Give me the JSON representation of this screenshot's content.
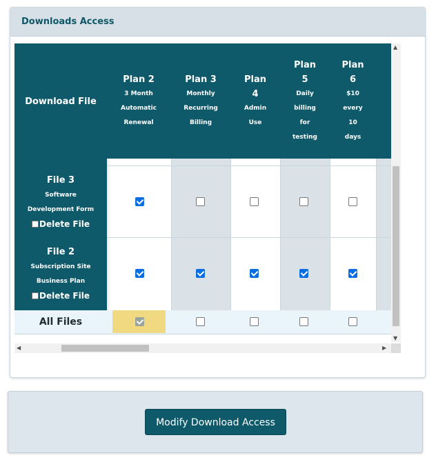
{
  "panel": {
    "title": "Downloads Access"
  },
  "table": {
    "corner_header": "Download File",
    "plans": [
      {
        "title": "Plan 2",
        "desc": [
          "3 Month",
          "Automatic",
          "Renewal"
        ]
      },
      {
        "title": "Plan 3",
        "desc": [
          "Monthly",
          "Recurring",
          "Billing"
        ]
      },
      {
        "title": [
          "Plan",
          "4"
        ],
        "desc": [
          "Admin",
          "Use"
        ]
      },
      {
        "title": [
          "Plan",
          "5"
        ],
        "desc": [
          "Daily",
          "billing",
          "for",
          "testing"
        ]
      },
      {
        "title": [
          "Plan",
          "6"
        ],
        "desc": [
          "$10",
          "every",
          "10",
          "days"
        ]
      }
    ],
    "rows": [
      {
        "name": "File 3",
        "desc": [
          "Software",
          "Development Form"
        ],
        "delete_label": "Delete File",
        "checks": [
          true,
          false,
          false,
          false,
          false
        ]
      },
      {
        "name": "File 2",
        "desc": [
          "Subscription Site",
          "Business Plan"
        ],
        "delete_label": "Delete File",
        "checks": [
          true,
          true,
          true,
          true,
          true
        ]
      }
    ],
    "all_files": {
      "label": "All Files",
      "checks": [
        true,
        false,
        false,
        false,
        false
      ]
    }
  },
  "footer": {
    "button_label": "Modify Download Access"
  },
  "colors": {
    "header_bg": "#0e5a6b",
    "shade_col": "#dae2e8",
    "all_row_bg": "#eaf4fb",
    "highlight": "#f0d980",
    "check_on": "#0a6ee0"
  }
}
